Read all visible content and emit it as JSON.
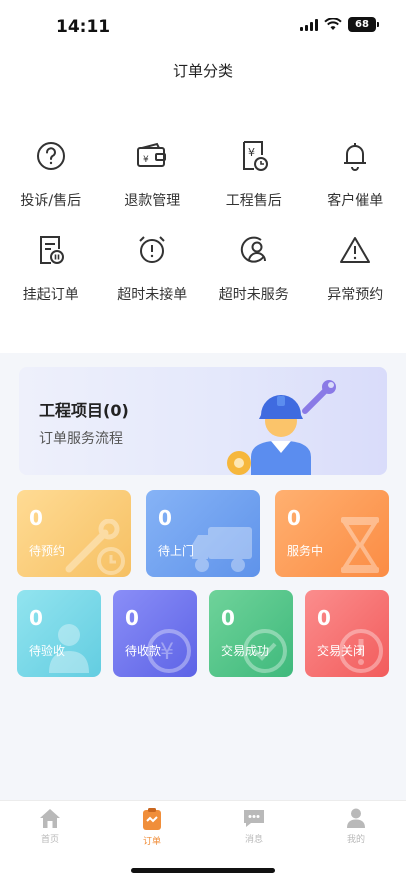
{
  "status": {
    "time": "14:11",
    "battery": "68"
  },
  "header": {
    "title": "订单分类"
  },
  "categories": [
    {
      "label": "投诉/售后",
      "icon": "question-circle-icon"
    },
    {
      "label": "退款管理",
      "icon": "wallet-refund-icon"
    },
    {
      "label": "工程售后",
      "icon": "receipt-clock-icon"
    },
    {
      "label": "客户催单",
      "icon": "bell-icon"
    },
    {
      "label": "挂起订单",
      "icon": "paused-document-icon"
    },
    {
      "label": "超时未接单",
      "icon": "alarm-clock-icon"
    },
    {
      "label": "超时未服务",
      "icon": "user-circle-icon"
    },
    {
      "label": "异常预约",
      "icon": "warning-triangle-icon"
    }
  ],
  "project": {
    "title": "工程项目(0)",
    "subtitle": "订单服务流程"
  },
  "order_status": [
    {
      "count": "0",
      "label": "待预约",
      "color": "#f6c063"
    },
    {
      "count": "0",
      "label": "待上门",
      "color": "#5f93ea"
    },
    {
      "count": "0",
      "label": "服务中",
      "color": "#fb8c44"
    },
    {
      "count": "0",
      "label": "待验收",
      "color": "#63cde1"
    },
    {
      "count": "0",
      "label": "待收款",
      "color": "#5d63e6"
    },
    {
      "count": "0",
      "label": "交易成功",
      "color": "#3fb97c"
    },
    {
      "count": "0",
      "label": "交易关闭",
      "color": "#f25c5c"
    }
  ],
  "tabs": [
    {
      "label": "首页",
      "icon": "home-icon"
    },
    {
      "label": "订单",
      "icon": "clipboard-icon",
      "active": true
    },
    {
      "label": "消息",
      "icon": "chat-icon"
    },
    {
      "label": "我的",
      "icon": "person-icon"
    }
  ],
  "colors": {
    "accent": "#f08e3a",
    "page_background": "#f4f6fa"
  }
}
